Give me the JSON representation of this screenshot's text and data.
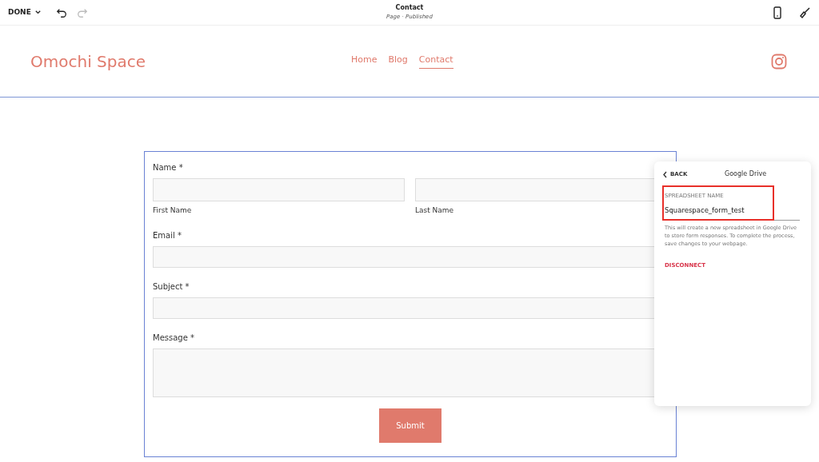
{
  "toolbar": {
    "done": "DONE",
    "title": "Contact",
    "subtitle": "Page · Published"
  },
  "site": {
    "logo": "Omochi Space",
    "nav": [
      {
        "label": "Home",
        "selected": false
      },
      {
        "label": "Blog",
        "selected": false
      },
      {
        "label": "Contact",
        "selected": true
      }
    ]
  },
  "form": {
    "fields": [
      {
        "kind": "name",
        "label": "Name *",
        "parts": [
          "First Name",
          "Last Name"
        ]
      },
      {
        "kind": "text",
        "label": "Email *"
      },
      {
        "kind": "text",
        "label": "Subject *"
      },
      {
        "kind": "textarea",
        "label": "Message *"
      }
    ],
    "submit": "Submit"
  },
  "panel": {
    "back": "BACK",
    "title": "Google Drive",
    "field_label": "SPREADSHEET NAME",
    "field_value": "Squarespace_form_test",
    "help": "This will create a new spreadsheet in Google Drive to store form responses. To complete the process, save changes to your webpage.",
    "disconnect": "DISCONNECT"
  }
}
